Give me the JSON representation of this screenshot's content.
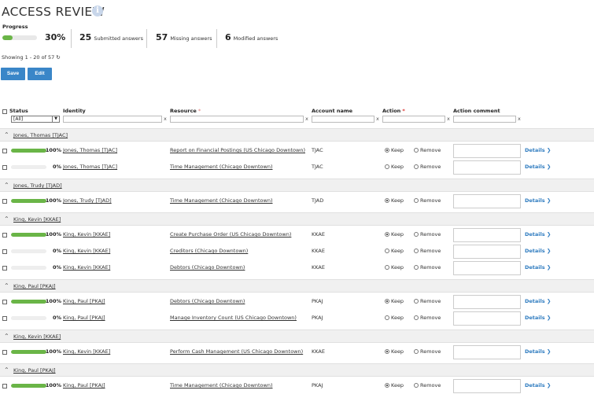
{
  "page": {
    "title": "ACCESS REVIEW",
    "info_icon": "info-icon"
  },
  "progress": {
    "label": "Progress",
    "percent": 30,
    "percent_text": "30%"
  },
  "stats": [
    {
      "value": "25",
      "label": "Submitted answers"
    },
    {
      "value": "57",
      "label": "Missing answers"
    },
    {
      "value": "6",
      "label": "Modified answers"
    }
  ],
  "showing": {
    "text": "Showing 1 - 20 of 57",
    "icon": "refresh-icon"
  },
  "toolbar": {
    "save_label": "Save",
    "edit_label": "Edit"
  },
  "columns": {
    "status": "Status",
    "identity": "Identity",
    "resource": "Resource",
    "account": "Account name",
    "action": "Action",
    "comment": "Action comment",
    "required_marker": "*"
  },
  "filters": {
    "status_selected": "[All]",
    "clear_symbol": "x"
  },
  "radio_labels": {
    "keep": "Keep",
    "remove": "Remove"
  },
  "details_label": "Details",
  "groups": [
    {
      "label": "Jones, Thomas [TJAC]",
      "rows": [
        {
          "progress": 100,
          "pct": "100%",
          "identity": "Jones, Thomas [TJAC]",
          "resource": "Report on Financial Postings (US Chicago Downtown)",
          "account": "TJAC",
          "action": "keep"
        },
        {
          "progress": 0,
          "pct": "0%",
          "identity": "Jones, Thomas [TJAC]",
          "resource": "Time Management (Chicago Downtown)",
          "account": "TJAC",
          "action": "none"
        }
      ]
    },
    {
      "label": "Jones, Trudy [TJAD]",
      "rows": [
        {
          "progress": 100,
          "pct": "100%",
          "identity": "Jones, Trudy [TJAD]",
          "resource": "Time Management (Chicago Downtown)",
          "account": "TJAD",
          "action": "keep"
        }
      ]
    },
    {
      "label": "King, Kevin [KKAE]",
      "rows": [
        {
          "progress": 100,
          "pct": "100%",
          "identity": "King, Kevin [KKAE]",
          "resource": "Create Purchase Order (US Chicago Downtown)",
          "account": "KKAE",
          "action": "keep"
        },
        {
          "progress": 0,
          "pct": "0%",
          "identity": "King, Kevin [KKAE]",
          "resource": "Creditors (Chicago Downtown)",
          "account": "KKAE",
          "action": "none"
        },
        {
          "progress": 0,
          "pct": "0%",
          "identity": "King, Kevin [KKAE]",
          "resource": "Debtors (Chicago Downtown)",
          "account": "KKAE",
          "action": "none"
        }
      ]
    },
    {
      "label": "King, Paul [PKAJ]",
      "rows": [
        {
          "progress": 100,
          "pct": "100%",
          "identity": "King, Paul [PKAJ]",
          "resource": "Debtors (Chicago Downtown)",
          "account": "PKAJ",
          "action": "keep"
        },
        {
          "progress": 0,
          "pct": "0%",
          "identity": "King, Paul [PKAJ]",
          "resource": "Manage Inventory Count (US Chicago Downtown)",
          "account": "PKAJ",
          "action": "none"
        }
      ]
    },
    {
      "label": "King, Kevin [KKAE]",
      "rows": [
        {
          "progress": 100,
          "pct": "100%",
          "identity": "King, Kevin [KKAE]",
          "resource": "Perform Cash Management (US Chicago Downtown)",
          "account": "KKAE",
          "action": "keep"
        }
      ]
    },
    {
      "label": "King, Paul [PKAJ]",
      "rows": [
        {
          "progress": 100,
          "pct": "100%",
          "identity": "King, Paul [PKAJ]",
          "resource": "Time Management (Chicago Downtown)",
          "account": "PKAJ",
          "action": "keep"
        }
      ]
    }
  ],
  "colors": {
    "accent": "#3a86c8",
    "progress_fill": "#6ab547",
    "link": "#2f7cc0",
    "required": "#d9302c"
  }
}
